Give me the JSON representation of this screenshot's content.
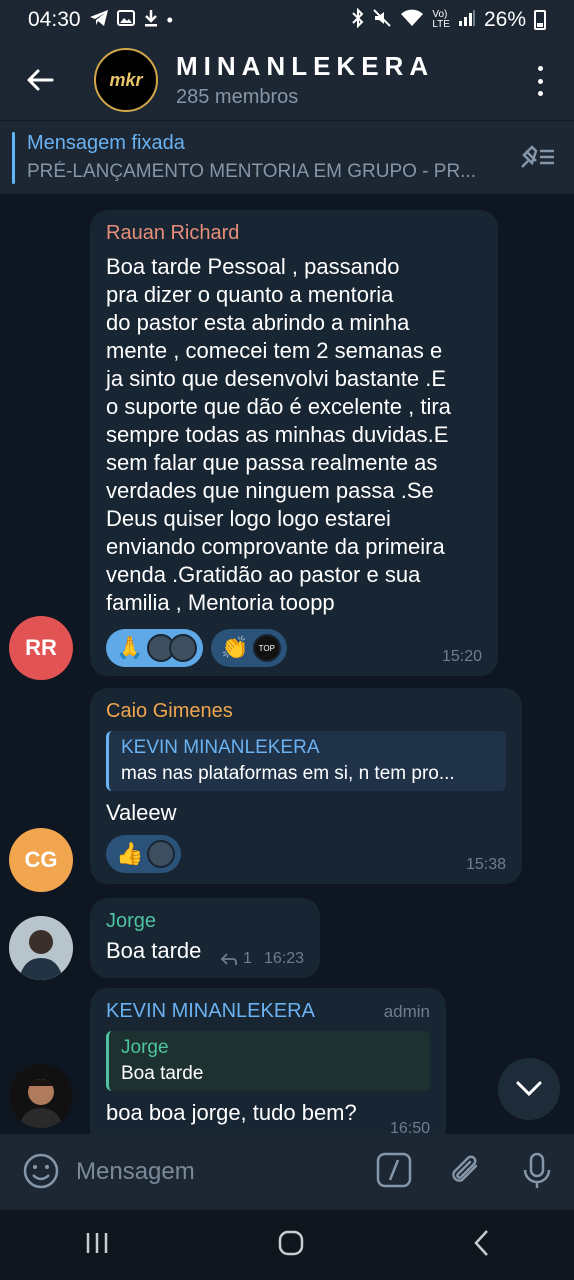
{
  "status_bar": {
    "time": "04:30",
    "battery": "26%"
  },
  "header": {
    "title": "MINANLEKERA",
    "subtitle": "285 membros",
    "avatar_text": "mkr"
  },
  "pinned": {
    "title": "Mensagem fixada",
    "text": "PRÉ-LANÇAMENTO MENTORIA EM GRUPO - PR..."
  },
  "messages": [
    {
      "sender": "Rauan Richard",
      "sender_color": "#e88e7a",
      "avatar_initials": "RR",
      "avatar_color": "#e25353",
      "text": "Boa tarde Pessoal , passando\npra dizer o quanto a mentoria\ndo pastor esta abrindo a minha\nmente , comecei tem 2 semanas e\nja sinto que desenvolvi bastante .E\no suporte que dão é excelente , tira\nsempre todas as minhas duvidas.E\nsem falar que passa realmente as\nverdades que ninguem passa .Se\nDeus quiser logo logo estarei\nenviando comprovante da primeira\nvenda .Gratidão ao pastor e sua\nfamilia  , Mentoria toopp",
      "reactions": [
        {
          "emoji": "🙏"
        },
        {
          "emoji": "👏",
          "avatar_label": "TOP"
        }
      ],
      "time": "15:20"
    },
    {
      "sender": "Caio Gimenes",
      "sender_color": "#f0a54e",
      "avatar_initials": "CG",
      "avatar_color": "#f0a54e",
      "reply_name": "KEVIN MINANLEKERA",
      "reply_text": "mas nas plataformas em si, n tem pro...",
      "text": "Valeew",
      "reactions": [
        {
          "emoji": "👍"
        }
      ],
      "time": "15:38"
    },
    {
      "sender": "Jorge",
      "sender_color": "#4fc3a1",
      "text": "Boa tarde",
      "reply_count": "1",
      "time": "16:23"
    },
    {
      "sender": "KEVIN MINANLEKERA",
      "sender_color": "#6ab2f2",
      "badge": "admin",
      "reply_name": "Jorge",
      "reply_text": "Boa tarde",
      "text": "boa boa jorge, tudo bem?",
      "time": "16:50"
    }
  ],
  "input": {
    "placeholder": "Mensagem"
  }
}
